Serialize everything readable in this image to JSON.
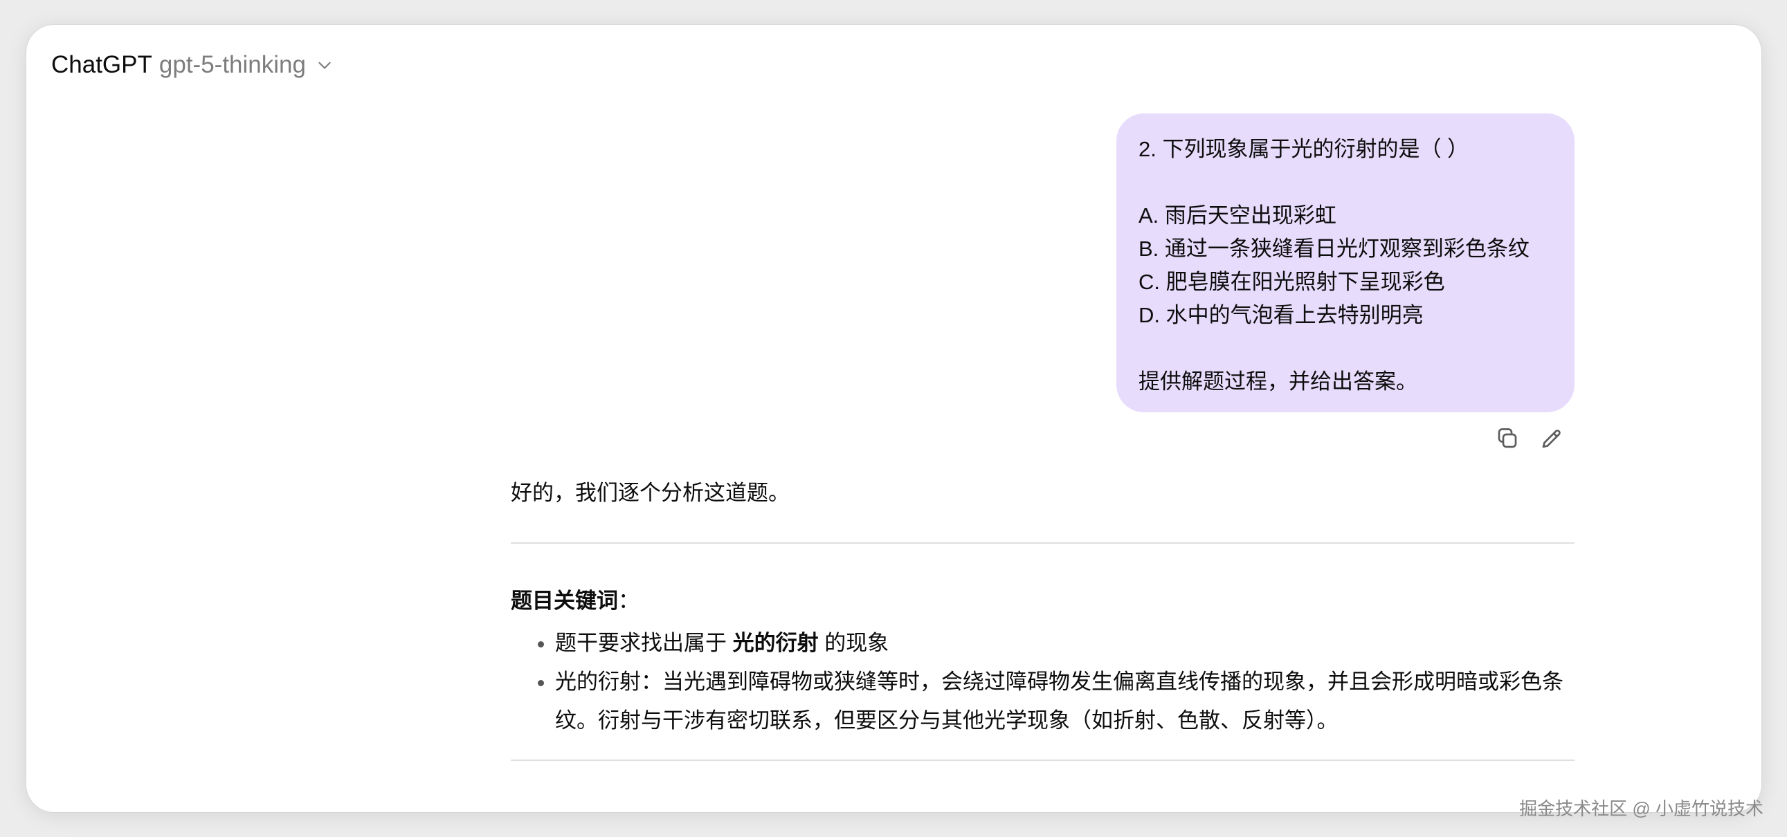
{
  "header": {
    "app_name": "ChatGPT",
    "model": "gpt-5-thinking"
  },
  "user_message": {
    "lines": [
      "2. 下列现象属于光的衍射的是（ ）",
      "",
      "A. 雨后天空出现彩虹",
      "B. 通过一条狭缝看日光灯观察到彩色条纹",
      "C. 肥皂膜在阳光照射下呈现彩色",
      "D. 水中的气泡看上去特别明亮",
      "",
      "提供解题过程，并给出答案。"
    ]
  },
  "message_actions": {
    "copy_icon": "copy-icon",
    "edit_icon": "edit-pencil-icon"
  },
  "assistant": {
    "intro": "好的，我们逐个分析这道题。",
    "section_title": "题目关键词",
    "section_colon": "：",
    "bullet1_pre": "题干要求找出属于 ",
    "bullet1_bold": "光的衍射",
    "bullet1_post": " 的现象",
    "bullet2": "光的衍射：当光遇到障碍物或狭缝等时，会绕过障碍物发生偏离直线传播的现象，并且会形成明暗或彩色条纹。衍射与干涉有密切联系，但要区分与其他光学现象（如折射、色散、反射等）。"
  },
  "watermark": "掘金技术社区 @ 小虚竹说技术",
  "colors": {
    "user_bubble": "#e7dcfc",
    "background": "#ececec",
    "window": "#ffffff"
  }
}
